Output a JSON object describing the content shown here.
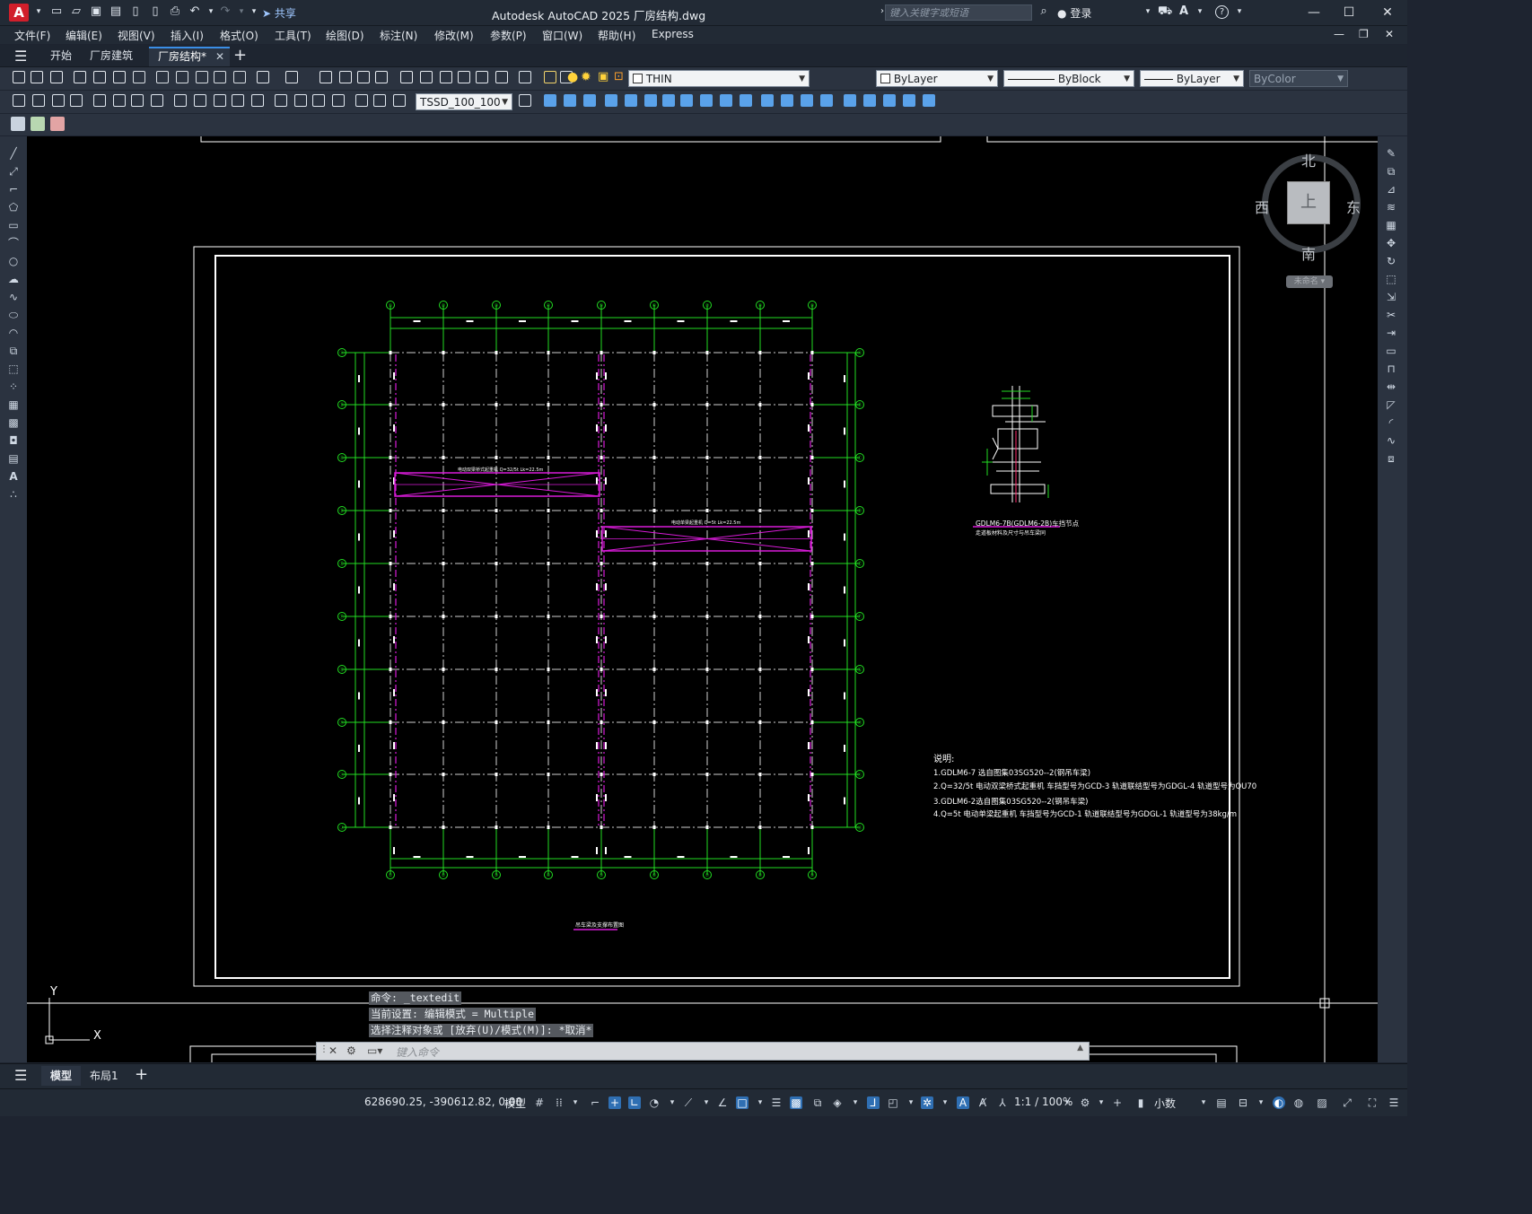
{
  "app": {
    "logo": "A",
    "title": "Autodesk AutoCAD 2025    厂房结构.dwg",
    "share_label": "共享",
    "search_placeholder": "键入关键字或短语",
    "login_label": "登录"
  },
  "menu": [
    "文件(F)",
    "编辑(E)",
    "视图(V)",
    "插入(I)",
    "格式(O)",
    "工具(T)",
    "绘图(D)",
    "标注(N)",
    "修改(M)",
    "参数(P)",
    "窗口(W)",
    "帮助(H)",
    "Express"
  ],
  "tabs": {
    "start": "开始",
    "items": [
      "厂房建筑",
      "厂房结构*"
    ]
  },
  "toolbar": {
    "linetype_scale": "THIN",
    "dimstyle": "TSSD_100_100",
    "color": "ByLayer",
    "linetype": "ByBlock",
    "lineweight": "ByLayer",
    "plotstyle": "ByColor"
  },
  "viewcube": {
    "north": "北",
    "south": "南",
    "east": "东",
    "west": "西",
    "top": "上",
    "wcs": "未命名"
  },
  "ucs": {
    "y": "Y",
    "x": "X"
  },
  "drawing": {
    "column_labels": [
      "①",
      "②",
      "③",
      "④",
      "⑤",
      "⑥",
      "⑦",
      "⑧",
      "⑨"
    ],
    "row_labels": [
      "Ⓐ",
      "Ⓑ",
      "Ⓒ",
      "Ⓓ",
      "Ⓔ",
      "Ⓕ",
      "Ⓖ",
      "Ⓗ",
      "Ⓘ",
      "Ⓙ"
    ],
    "crane1_label": "电动双梁桥式起重机 Q=32/5t Lk=22.5m",
    "crane2_label": "电动单梁起重机 Q=5t Lk=22.5m",
    "plan_title": "吊车梁及支撑布置图",
    "detail_title": "GDLM6-7B(GDLM6-2B)车挡节点",
    "detail_subtitle": "走道板材料及尺寸与吊车梁同",
    "notes": {
      "heading": "说明:",
      "lines": [
        "1.GDLM6-7 选自图集03SG520--2(钢吊车梁)",
        "2.Q=32/5t 电动双梁桥式起重机 车挡型号为GCD-3   轨道联结型号为GDGL-4 轨道型号为QU70",
        "3.GDLM6-2选自图集03SG520--2(钢吊车梁)",
        "4.Q=5t 电动单梁起重机   车挡型号为GCD-1  轨道联结型号为GDGL-1 轨道型号为38kg/m"
      ]
    }
  },
  "command": {
    "history": [
      "命令: _textedit",
      "当前设置: 编辑模式 = Multiple",
      "选择注释对象或 [放弃(U)/模式(M)]: *取消*"
    ],
    "placeholder": "键入命令"
  },
  "layouts": {
    "model": "模型",
    "layout1": "布局1"
  },
  "status": {
    "coords": "628690.25, -390612.82, 0.00",
    "mode": "模型",
    "scale": "1:1 / 100%",
    "units": "小数"
  }
}
